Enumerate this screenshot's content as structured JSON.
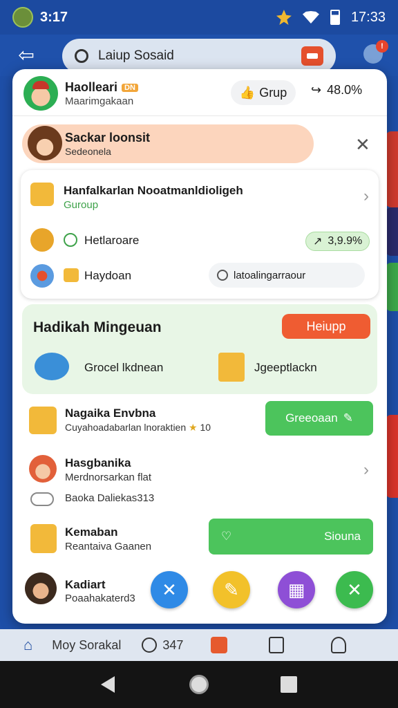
{
  "status_bar": {
    "left_time": "3:17",
    "right_time": "17:33"
  },
  "app_bar": {
    "search_text": "Laiup Sosaid",
    "notif_count": "!"
  },
  "header": {
    "name": "Haolleari",
    "tag": "DN",
    "subtitle": "Maarimgakaan",
    "group_button": "Grup",
    "share_value": "48.0%"
  },
  "banner": {
    "title": "Sackar loonsit",
    "subtitle": "Sedeonela"
  },
  "info_card": {
    "row1_title": "Hanfalkarlan Nooatmanldioligeh",
    "row1_sub": "Guroup",
    "row2_label": "Hetlaroare",
    "row2_badge": "3,9.9%",
    "row3_label": "Haydoan",
    "row3_search": "latoalingarraour"
  },
  "promo": {
    "title": "Hadikah Mingeuan",
    "button": "Heiupp",
    "item1": "Grocel lkdnean",
    "item2": "Jgeeptlackn"
  },
  "list": [
    {
      "title": "Nagaika Envbna",
      "sub": "Cuyahoadabarlan lnoraktien",
      "extra": "10",
      "button": "Greeoaan"
    },
    {
      "title": "Hasgbanika",
      "sub": "Merdnorsarkan flat",
      "extra2": "Baoka Daliekas313"
    },
    {
      "title": "Kemaban",
      "sub": "Reantaiva Gaanen",
      "button": "Siouna"
    },
    {
      "title": "Kadiart",
      "sub": "Poaahakaterd3"
    }
  ],
  "bottom_nav": {
    "label": "Moy Sorakal",
    "count": "347"
  },
  "colors": {
    "accent_orange": "#ef5c32",
    "green": "#4cc45c",
    "nav_blue": "#1c4aa0"
  }
}
